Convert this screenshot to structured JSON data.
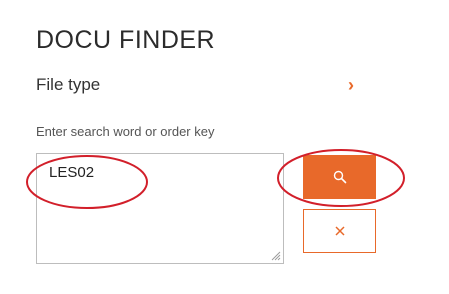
{
  "header": {
    "title": "DOCU FINDER"
  },
  "file_type": {
    "label": "File type",
    "chevron": "chevron-right-icon"
  },
  "search": {
    "hint": "Enter search word or order key",
    "value": "LES02"
  },
  "buttons": {
    "search_icon": "search-icon",
    "clear_icon": "close-icon"
  },
  "colors": {
    "accent": "#e8692a",
    "annotation": "#d21f2a",
    "border": "#bdbdbd"
  }
}
